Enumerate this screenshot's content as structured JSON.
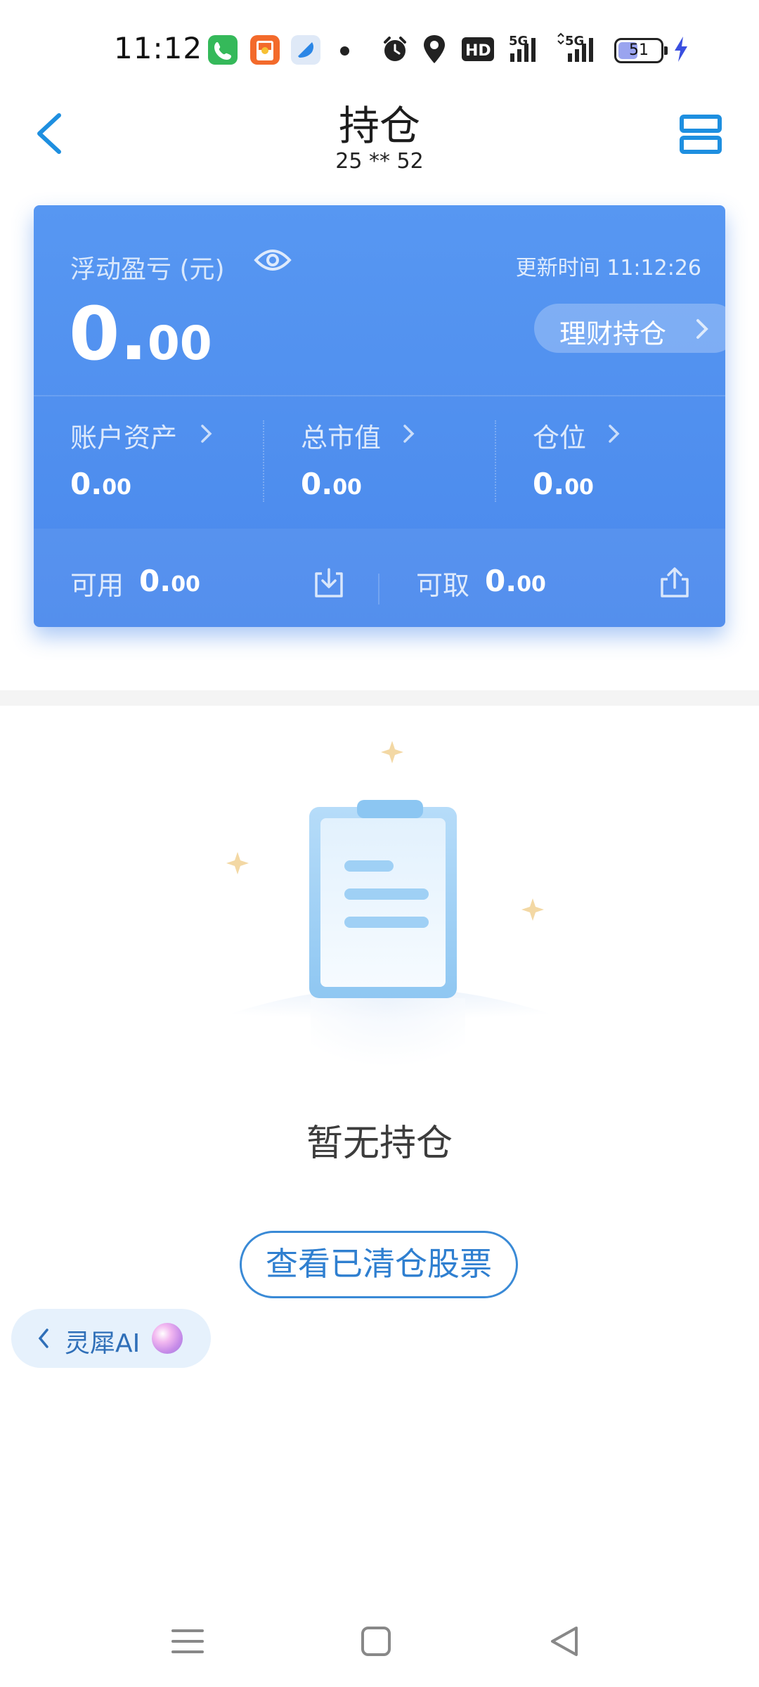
{
  "status_bar": {
    "time": "11:12",
    "network_hd": "HD",
    "network_1": "5G",
    "network_2": "5G",
    "battery_level": "51",
    "battery_percent": 51
  },
  "header": {
    "title": "持仓",
    "account_masked": "25 ** 52"
  },
  "card": {
    "floating_pl_label": "浮动盈亏 (元)",
    "update_time_label": "更新时间 11:12:26",
    "pl_integer": "0.",
    "pl_decimal": "00",
    "wealth_button_label": "理财持仓",
    "metrics": [
      {
        "label": "账户资产",
        "int": "0.",
        "dec": "00"
      },
      {
        "label": "总市值",
        "int": "0.",
        "dec": "00"
      },
      {
        "label": "仓位",
        "int": "0.",
        "dec": "00"
      }
    ],
    "available_label": "可用",
    "available_int": "0.",
    "available_dec": "00",
    "withdrawable_label": "可取",
    "withdrawable_int": "0.",
    "withdrawable_dec": "00"
  },
  "empty_state": {
    "text": "暂无持仓",
    "cleared_button_label": "查看已清仓股票"
  },
  "ai_pill": {
    "label": "灵犀AI"
  },
  "icons": {
    "back": "chevron-left-icon",
    "menu": "menu-icon",
    "eye": "eye-icon",
    "deposit": "deposit-icon",
    "transfer_out": "transfer-out-icon"
  },
  "colors": {
    "card_blue": "#4a89ec",
    "accent_blue": "#2f7fd0",
    "icon_blue": "#1e8fe0"
  }
}
